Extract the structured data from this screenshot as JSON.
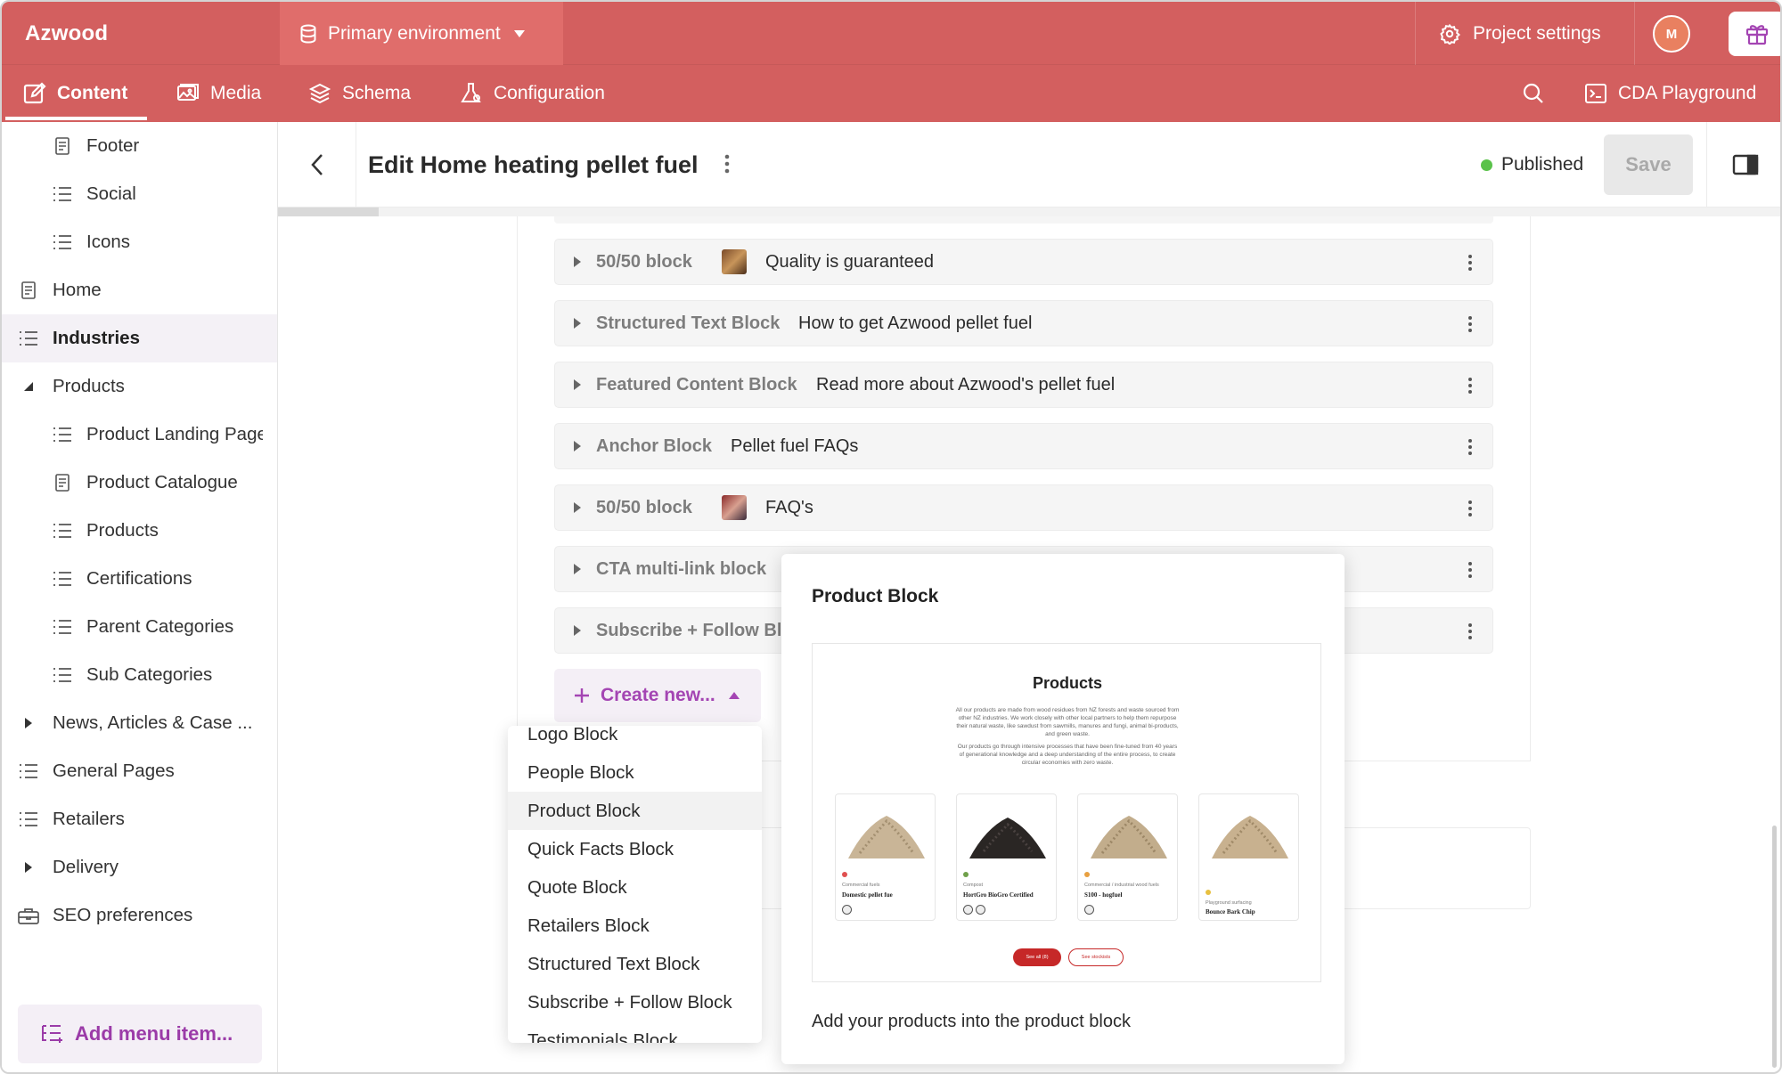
{
  "app": {
    "brand": "Azwood",
    "environment": "Primary environment",
    "project_settings": "Project settings",
    "avatar_initial": "M"
  },
  "nav": {
    "tabs": [
      {
        "label": "Content",
        "icon": "edit-icon",
        "active": true
      },
      {
        "label": "Media",
        "icon": "image-icon",
        "active": false
      },
      {
        "label": "Schema",
        "icon": "layers-icon",
        "active": false
      },
      {
        "label": "Configuration",
        "icon": "flask-icon",
        "active": false
      }
    ],
    "cda_playground": "CDA Playground"
  },
  "sidebar": {
    "items": [
      {
        "label": "Footer",
        "icon": "page-icon",
        "depth": 1
      },
      {
        "label": "Social",
        "icon": "list-icon",
        "depth": 1
      },
      {
        "label": "Icons",
        "icon": "list-icon",
        "depth": 1
      },
      {
        "label": "Home",
        "icon": "page-icon",
        "depth": 0
      },
      {
        "label": "Industries",
        "icon": "list-icon",
        "depth": 0,
        "active": true
      },
      {
        "label": "Products",
        "icon": "caret-down-icon",
        "depth": 0
      },
      {
        "label": "Product Landing Page",
        "icon": "list-icon",
        "depth": 1
      },
      {
        "label": "Product Catalogue",
        "icon": "page-icon",
        "depth": 1
      },
      {
        "label": "Products",
        "icon": "list-icon",
        "depth": 1
      },
      {
        "label": "Certifications",
        "icon": "list-icon",
        "depth": 1
      },
      {
        "label": "Parent Categories",
        "icon": "list-icon",
        "depth": 1
      },
      {
        "label": "Sub Categories",
        "icon": "list-icon",
        "depth": 1
      },
      {
        "label": "News, Articles & Case ...",
        "icon": "caret-right-icon",
        "depth": 0
      },
      {
        "label": "General Pages",
        "icon": "list-icon",
        "depth": 0
      },
      {
        "label": "Retailers",
        "icon": "list-icon",
        "depth": 0
      },
      {
        "label": "Delivery",
        "icon": "caret-right-icon",
        "depth": 0
      },
      {
        "label": "SEO preferences",
        "icon": "toolbox-icon",
        "depth": 0
      }
    ],
    "add_menu_item": "Add menu item..."
  },
  "editor": {
    "title": "Edit Home heating pellet fuel",
    "status": "Published",
    "save_label": "Save",
    "status_color": "#5ac24a"
  },
  "blocks": [
    {
      "type": "50/50 block",
      "title": "Quality is guaranteed",
      "thumb": true
    },
    {
      "type": "Structured Text Block",
      "title": "How to get Azwood pellet fuel",
      "thumb": false
    },
    {
      "type": "Featured Content Block",
      "title": "Read more about Azwood's pellet fuel",
      "thumb": false
    },
    {
      "type": "Anchor Block",
      "title": "Pellet fuel FAQs",
      "thumb": false
    },
    {
      "type": "50/50 block",
      "title": "FAQ's",
      "thumb": true
    },
    {
      "type": "CTA multi-link block",
      "title": "",
      "thumb": false
    },
    {
      "type": "Subscribe + Follow Blo",
      "title": "",
      "thumb": false
    }
  ],
  "create_new": "Create new...",
  "dropdown": {
    "items": [
      "Logo Block",
      "People Block",
      "Product Block",
      "Quick Facts Block",
      "Quote Block",
      "Retailers Block",
      "Structured Text Block",
      "Subscribe + Follow Block",
      "Testimonials Block"
    ],
    "highlighted": "Product Block"
  },
  "preview": {
    "title": "Product Block",
    "mini_heading": "Products",
    "mini_text_1": "All our products are made from wood residues from NZ forests and waste sourced from other NZ industries. We work closely with other local partners to help them repurpose their natural waste, like sawdust from sawmills, manures and fungi, animal bi-products, and green waste.",
    "mini_text_2": "Our products go through intensive processes that have been fine-tuned from 40 years of generational knowledge and a deep understanding of the entire process, to create circular economies with zero waste.",
    "products": [
      {
        "category": "Commercial fuels",
        "name": "Domestic pellet fue",
        "color": "#c9b597",
        "tag": "#e05050"
      },
      {
        "category": "Compost",
        "name": "HortGro BioGro Certified",
        "color": "#2a2624",
        "tag": "#6fa04a"
      },
      {
        "category": "Commercial / industrial wood fuels",
        "name": "S100 - hogfuel",
        "color": "#c2ad8c",
        "tag": "#e8a040"
      },
      {
        "category": "Playground surfacing",
        "name": "Bounce Bark Chip",
        "color": "#c8b18f",
        "tag": "#e8c040"
      }
    ],
    "btn_see_all": "See all (8)",
    "btn_stockists": "See stockists",
    "description": "Add your products into the product block"
  },
  "colors": {
    "brand": "#d35f5f",
    "accent": "#a445b3"
  }
}
